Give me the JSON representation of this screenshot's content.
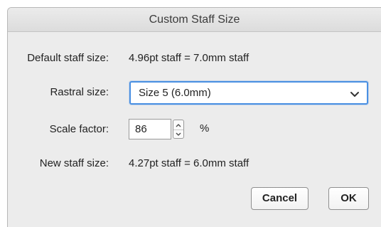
{
  "dialog": {
    "title": "Custom Staff Size"
  },
  "default_staff_size": {
    "label": "Default staff size:",
    "value": "4.96pt staff = 7.0mm staff"
  },
  "rastral_size": {
    "label": "Rastral size:",
    "selected": "Size 5 (6.0mm)",
    "icon": "chevron-down-icon"
  },
  "scale_factor": {
    "label": "Scale factor:",
    "value": "86",
    "unit": "%"
  },
  "new_staff_size": {
    "label": "New staff size:",
    "value": "4.27pt staff = 6.0mm staff"
  },
  "buttons": {
    "cancel": "Cancel",
    "ok": "OK"
  },
  "colors": {
    "focus_ring": "#4a90e2",
    "dialog_bg": "#ececec"
  }
}
